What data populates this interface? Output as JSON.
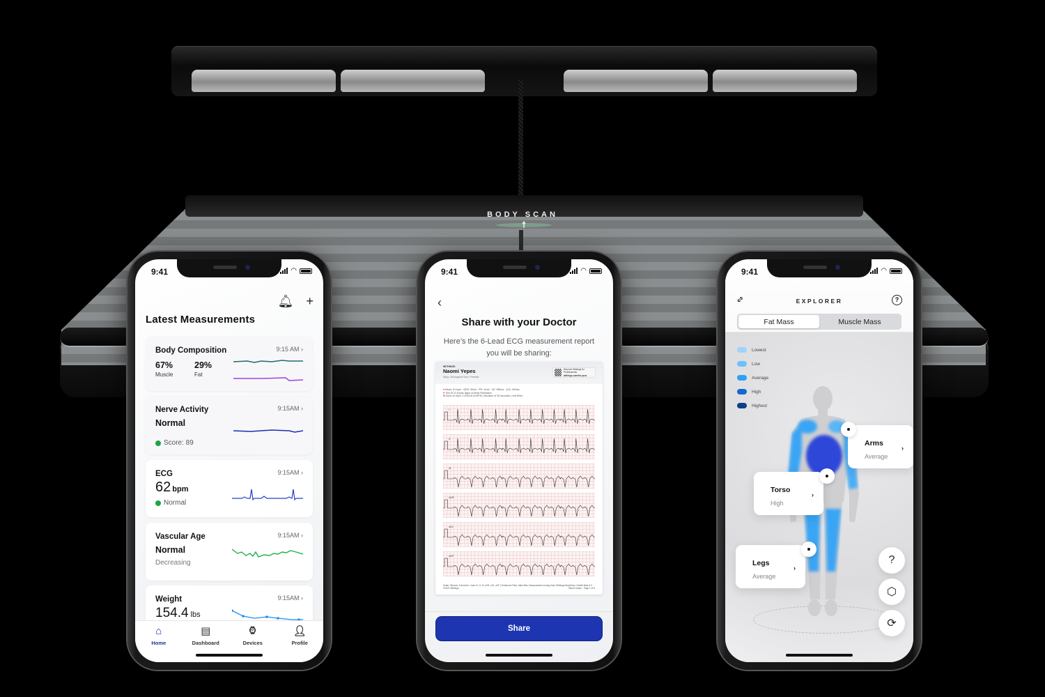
{
  "hardware": {
    "scale_label": "BODY SCAN",
    "figure_glyph": "☨"
  },
  "status_bar": {
    "time": "9:41"
  },
  "phone_home": {
    "icons": {
      "bell": "🔔︎",
      "add": "+"
    },
    "title": "Latest Measurements",
    "cards": [
      {
        "title": "Body Composition",
        "time": "9:15 AM",
        "metrics": [
          {
            "value": "67%",
            "label": "Muscle"
          },
          {
            "value": "29%",
            "label": "Fat"
          }
        ],
        "colors": [
          "#1f6b6b",
          "#a23ee0"
        ]
      },
      {
        "title": "Nerve Activity",
        "status": "Normal",
        "time": "9:15AM",
        "note": "Score: 89",
        "color": "#1a2fb0"
      },
      {
        "title": "ECG",
        "value": "62",
        "unit": "bpm",
        "time": "9:15AM",
        "note": "Normal",
        "color": "#2440c8"
      },
      {
        "title": "Vascular Age",
        "status": "Normal",
        "time": "9:15AM",
        "note": "Decreasing",
        "color": "#22b04a"
      },
      {
        "title": "Weight",
        "value": "154.4",
        "unit": "lbs",
        "time": "9:15AM",
        "color": "#1d8ef0"
      }
    ],
    "tabs": [
      {
        "label": "Home",
        "icon": "home-icon",
        "glyph": "⌂",
        "active": true
      },
      {
        "label": "Dashboard",
        "icon": "dashboard-icon",
        "glyph": "▤",
        "active": false
      },
      {
        "label": "Devices",
        "icon": "watch-icon",
        "glyph": "⌚︎",
        "active": false
      },
      {
        "label": "Profile",
        "icon": "person-icon",
        "glyph": "👤︎",
        "active": false
      }
    ]
  },
  "phone_share": {
    "back": "‹",
    "title": "Share with your Doctor",
    "description": "Here’s the 6-Lead ECG measurement report you will be sharing:",
    "report": {
      "brand": "WITHINGS",
      "patient_name": "Naomi Yepes",
      "patient_meta": "58yo, Biological Sex: Female",
      "qr_line1": "Discover Withings for Professionals",
      "qr_line2": "withings.com/for-pros",
      "notes": [
        "Mean: 81 bpm · QRS: 90ms · PR: 11ms · QT: 385ms · QTc: 400ms",
        "This ECG shows signs of Atrial Fibrillation.",
        "Done on April, 3 2018 at 8:49PM | Duration of 30 seconds | Left Wrist"
      ],
      "leads": [
        "I",
        "II",
        "III",
        "aVR",
        "aVL",
        "aVF"
      ],
      "footer_left": "Scale: 25mm/s, 10mm/mV, Lead II I, II, III, aVR, aVL, aVF | Enhanced Filter, Main filter. Measurement coming from Withings BodyScan, Health Mate 5.3",
      "footer_copy": "©2022 Withings",
      "footer_right": "Naomi Yepes · Page 1 of 5"
    },
    "share_label": "Share",
    "accent": "#1d35b0"
  },
  "phone_explorer": {
    "title": "EXPLORER",
    "help": "?",
    "segments": [
      {
        "label": "Fat Mass",
        "active": true
      },
      {
        "label": "Muscle Mass",
        "active": false
      }
    ],
    "legend": [
      {
        "label": "Lowest",
        "color": "#9fd3fb"
      },
      {
        "label": "Low",
        "color": "#6cc0fb"
      },
      {
        "label": "Average",
        "color": "#2f9ef5"
      },
      {
        "label": "High",
        "color": "#1668cf"
      },
      {
        "label": "Highest",
        "color": "#0f3f86"
      }
    ],
    "regions": [
      {
        "name": "Arms",
        "value": "Average"
      },
      {
        "name": "Torso",
        "value": "High"
      },
      {
        "name": "Legs",
        "value": "Average"
      }
    ],
    "fabs": {
      "help": "?",
      "rotate3d": "⬡",
      "replay": "⟳"
    }
  }
}
